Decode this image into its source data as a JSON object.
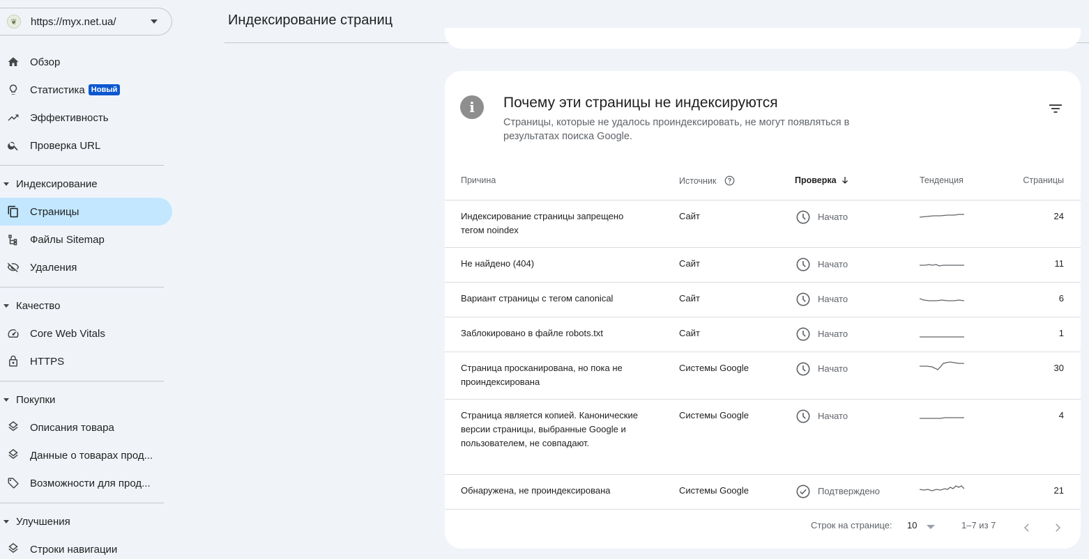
{
  "property": {
    "url": "https://myx.net.ua/",
    "icon": "site-favicon"
  },
  "nav": {
    "overview": "Обзор",
    "stats": "Статистика",
    "stats_badge": "Новый",
    "performance": "Эффективность",
    "url_inspection": "Проверка URL",
    "indexing": "Индексирование",
    "pages": "Страницы",
    "sitemaps": "Файлы Sitemap",
    "removals": "Удаления",
    "quality": "Качество",
    "cwv": "Core Web Vitals",
    "https": "HTTPS",
    "shopping": "Покупки",
    "product_snippets": "Описания товара",
    "merchant_listings": "Данные о товарах прод...",
    "shopping_tab": "Возможности для прод...",
    "enhancements": "Улучшения",
    "breadcrumbs": "Строки навигации"
  },
  "header": {
    "title": "Индексирование страниц"
  },
  "card": {
    "title": "Почему эти страницы не индексируются",
    "subtitle": "Страницы, которые не удалось проиндексировать, не могут появляться в результатах поиска Google."
  },
  "table": {
    "headers": {
      "reason": "Причина",
      "source": "Источник",
      "validation": "Проверка",
      "trend": "Тенденция",
      "pages": "Страницы"
    },
    "rows": [
      {
        "reason": "Индексирование страницы запрещено тегом noindex",
        "source": "Сайт",
        "validation": "Начато",
        "pages": "24"
      },
      {
        "reason": "Не найдено (404)",
        "source": "Сайт",
        "validation": "Начато",
        "pages": "11"
      },
      {
        "reason": "Вариант страницы с тегом canonical",
        "source": "Сайт",
        "validation": "Начато",
        "pages": "6"
      },
      {
        "reason": "Заблокировано в файле robots.txt",
        "source": "Сайт",
        "validation": "Начато",
        "pages": "1"
      },
      {
        "reason": "Страница просканирована, но пока не проиндексирована",
        "source": "Системы Google",
        "validation": "Начато",
        "pages": "30"
      },
      {
        "reason": "Страница является копией. Канонические версии страницы, выбранные Google и пользователем, не совпадают.",
        "source": "Системы Google",
        "validation": "Начато",
        "pages": "4"
      },
      {
        "reason": "Обнаружена, не проиндексирована",
        "source": "Системы Google",
        "validation": "Подтверждено",
        "pages": "21"
      }
    ]
  },
  "footer": {
    "rows_per_page_label": "Строк на странице:",
    "rows_per_page_value": "10",
    "range": "1–7 из 7"
  }
}
